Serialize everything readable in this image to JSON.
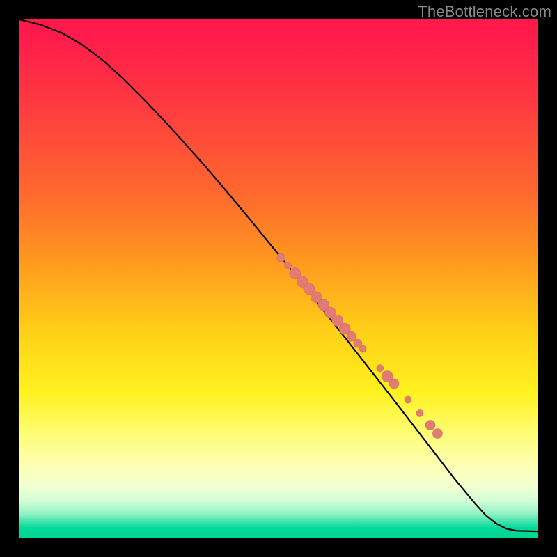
{
  "watermark": "TheBottleneck.com",
  "colors": {
    "curve": "#000000",
    "point_fill": "#e17b74",
    "point_stroke": "#d86a63"
  },
  "chart_data": {
    "type": "line",
    "title": "",
    "xlabel": "",
    "ylabel": "",
    "xlim": [
      0,
      100
    ],
    "ylim": [
      0,
      100
    ],
    "grid": false,
    "legend": "none",
    "series": [
      {
        "name": "curve",
        "x": [
          0,
          4,
          8,
          12,
          16,
          20,
          24,
          28,
          32,
          36,
          40,
          44,
          48,
          52,
          56,
          60,
          64,
          68,
          72,
          76,
          80,
          84,
          88,
          90,
          92,
          94,
          96,
          100
        ],
        "y": [
          100,
          99,
          97.5,
          95.2,
          92.2,
          88.6,
          84.6,
          80.4,
          76.0,
          71.5,
          66.8,
          62.0,
          57.1,
          52.2,
          47.2,
          42.2,
          37.1,
          32.0,
          26.9,
          21.7,
          16.5,
          11.3,
          6.5,
          4.3,
          2.7,
          1.7,
          1.3,
          1.2
        ]
      }
    ],
    "points": [
      {
        "x": 50.5,
        "y": 54.0,
        "r": 6
      },
      {
        "x": 51.8,
        "y": 52.5,
        "r": 5
      },
      {
        "x": 53.2,
        "y": 51.0,
        "r": 8
      },
      {
        "x": 54.6,
        "y": 49.4,
        "r": 8
      },
      {
        "x": 55.9,
        "y": 48.0,
        "r": 8
      },
      {
        "x": 57.3,
        "y": 46.4,
        "r": 8
      },
      {
        "x": 58.7,
        "y": 44.9,
        "r": 8
      },
      {
        "x": 60.0,
        "y": 43.4,
        "r": 8
      },
      {
        "x": 61.4,
        "y": 41.9,
        "r": 8
      },
      {
        "x": 62.8,
        "y": 40.3,
        "r": 8
      },
      {
        "x": 64.1,
        "y": 38.8,
        "r": 7
      },
      {
        "x": 65.3,
        "y": 37.5,
        "r": 6
      },
      {
        "x": 66.3,
        "y": 36.4,
        "r": 5
      },
      {
        "x": 69.6,
        "y": 32.7,
        "r": 5
      },
      {
        "x": 71.0,
        "y": 31.1,
        "r": 8
      },
      {
        "x": 72.3,
        "y": 29.7,
        "r": 7
      },
      {
        "x": 75.0,
        "y": 26.6,
        "r": 5
      },
      {
        "x": 77.3,
        "y": 24.0,
        "r": 5
      },
      {
        "x": 79.3,
        "y": 21.7,
        "r": 7
      },
      {
        "x": 80.7,
        "y": 20.1,
        "r": 7
      }
    ]
  }
}
